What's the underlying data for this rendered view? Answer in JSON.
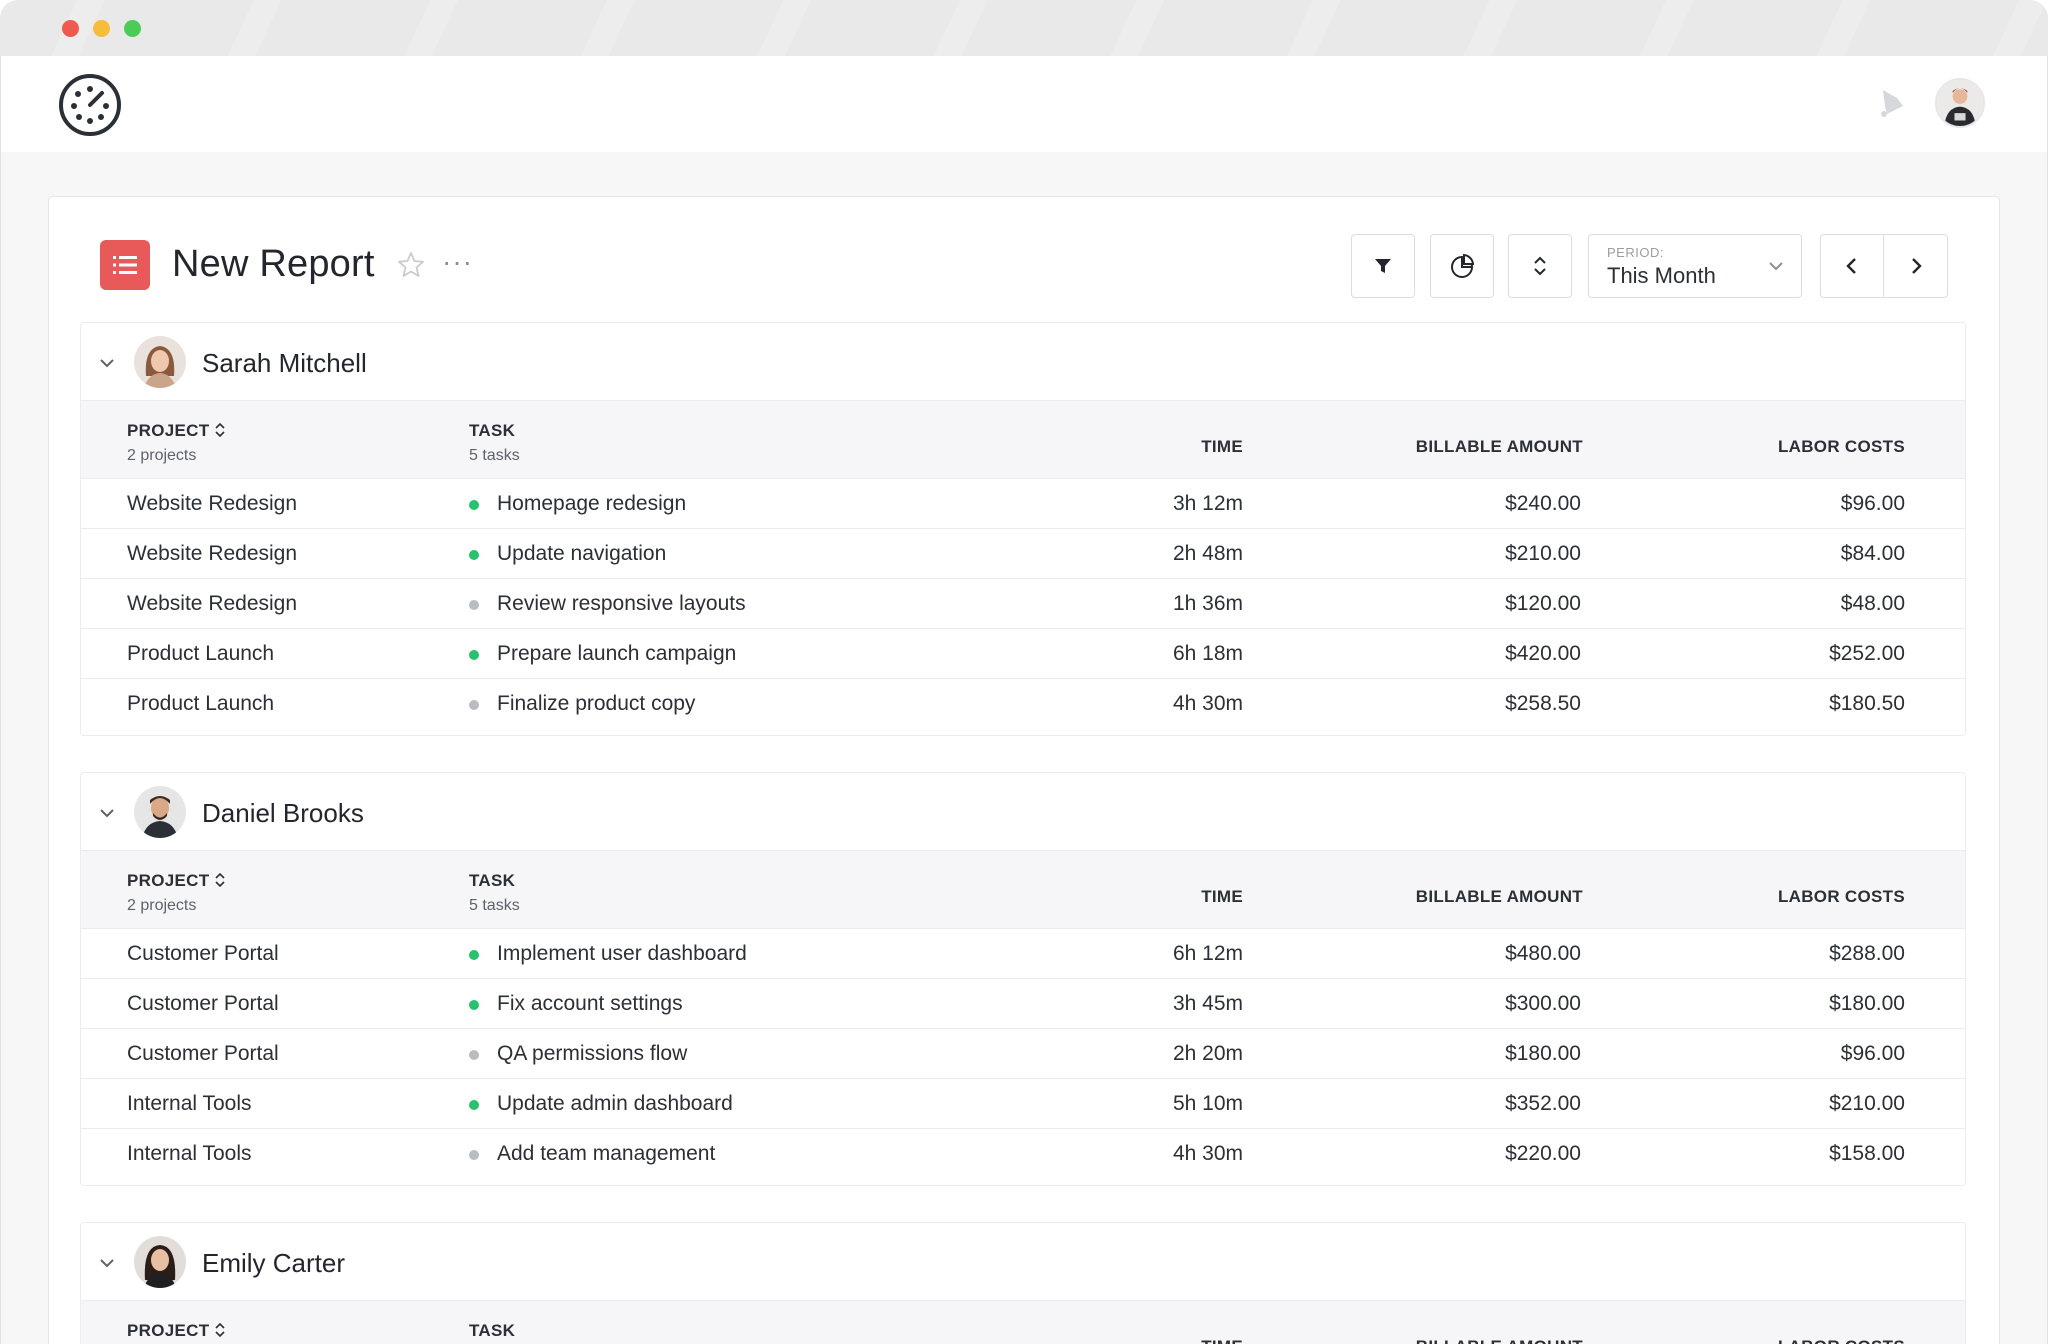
{
  "report": {
    "title": "New Report",
    "period_label": "PERIOD:",
    "period_value": "This Month",
    "more_label": "···"
  },
  "colors": {
    "accent": "#e85a5a",
    "status_active": "#27c26b",
    "status_inactive": "#b9bcc2"
  },
  "columns": {
    "project": "PROJECT",
    "task": "TASK",
    "time": "TIME",
    "billable": "BILLABLE AMOUNT",
    "labor": "LABOR COSTS"
  },
  "people": [
    {
      "name": "Sarah Mitchell",
      "projects_count": "2 projects",
      "tasks_count": "5 tasks",
      "rows": [
        {
          "project": "Website Redesign",
          "task": "Homepage redesign",
          "status": "active",
          "time": "3h 12m",
          "billable": "$240.00",
          "labor": "$96.00"
        },
        {
          "project": "Website Redesign",
          "task": "Update navigation",
          "status": "active",
          "time": "2h 48m",
          "billable": "$210.00",
          "labor": "$84.00"
        },
        {
          "project": "Website Redesign",
          "task": "Review responsive layouts",
          "status": "inactive",
          "time": "1h 36m",
          "billable": "$120.00",
          "labor": "$48.00"
        },
        {
          "project": "Product Launch",
          "task": "Prepare launch campaign",
          "status": "active",
          "time": "6h 18m",
          "billable": "$420.00",
          "labor": "$252.00"
        },
        {
          "project": "Product Launch",
          "task": "Finalize product copy",
          "status": "inactive",
          "time": "4h 30m",
          "billable": "$258.50",
          "labor": "$180.50"
        }
      ]
    },
    {
      "name": "Daniel Brooks",
      "projects_count": "2 projects",
      "tasks_count": "5 tasks",
      "rows": [
        {
          "project": "Customer Portal",
          "task": "Implement user dashboard",
          "status": "active",
          "time": "6h 12m",
          "billable": "$480.00",
          "labor": "$288.00"
        },
        {
          "project": "Customer Portal",
          "task": "Fix account settings",
          "status": "active",
          "time": "3h 45m",
          "billable": "$300.00",
          "labor": "$180.00"
        },
        {
          "project": "Customer Portal",
          "task": "QA permissions flow",
          "status": "inactive",
          "time": "2h 20m",
          "billable": "$180.00",
          "labor": "$96.00"
        },
        {
          "project": "Internal Tools",
          "task": "Update admin dashboard",
          "status": "active",
          "time": "5h 10m",
          "billable": "$352.00",
          "labor": "$210.00"
        },
        {
          "project": "Internal Tools",
          "task": "Add team management",
          "status": "inactive",
          "time": "4h 30m",
          "billable": "$220.00",
          "labor": "$158.00"
        }
      ]
    },
    {
      "name": "Emily Carter",
      "rows": []
    }
  ],
  "icons": {
    "logo": "timer-logo-icon",
    "bell": "bell-icon",
    "report": "list-icon",
    "star": "star-icon",
    "filter": "filter-icon",
    "chart": "pie-chart-icon",
    "sort": "sort-icon",
    "prev": "chevron-left-icon",
    "next": "chevron-right-icon",
    "collapse": "chevron-down-icon"
  }
}
